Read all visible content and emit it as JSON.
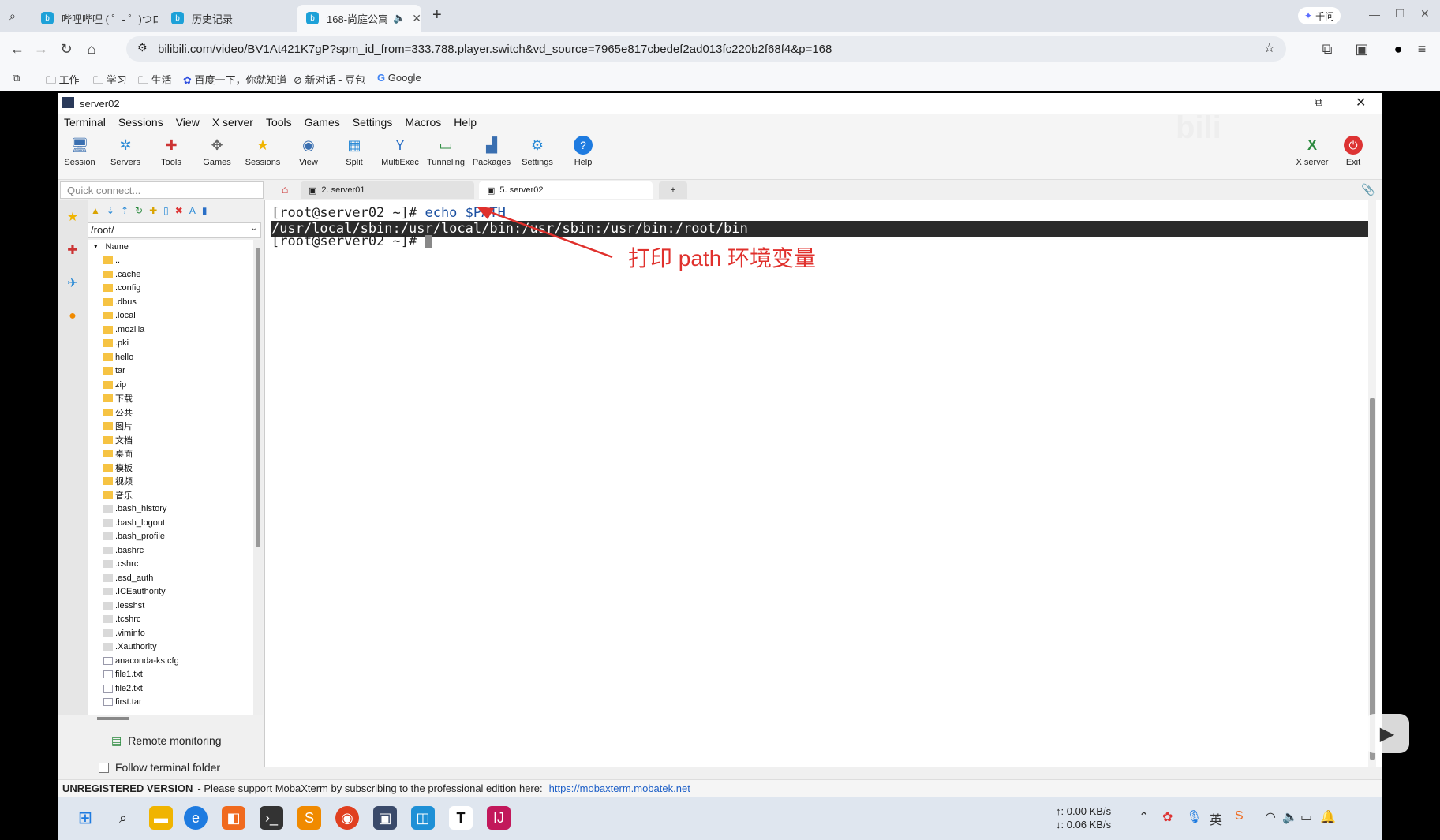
{
  "browser": {
    "tabs": [
      {
        "label": "哔哩哔哩 ( ゜- ゜)つロ"
      },
      {
        "label": "历史记录"
      },
      {
        "label": "168-尚庭公寓"
      }
    ],
    "qianwen": "千问",
    "url": "bilibili.com/video/BV1At421K7gP?spm_id_from=333.788.player.switch&vd_source=7965e817cbedef2ad013fc220b2f68f4&p=168",
    "bookmarks": [
      "工作",
      "学习",
      "生活",
      "百度一下，你就知道",
      "新对话 - 豆包",
      "Google"
    ]
  },
  "moba": {
    "title": "server02",
    "menu": [
      "Terminal",
      "Sessions",
      "View",
      "X server",
      "Tools",
      "Games",
      "Settings",
      "Macros",
      "Help"
    ],
    "toolbar": [
      "Session",
      "Servers",
      "Tools",
      "Games",
      "Sessions",
      "View",
      "Split",
      "MultiExec",
      "Tunneling",
      "Packages",
      "Settings",
      "Help"
    ],
    "xserver": "X server",
    "exit": "Exit",
    "quick_connect": "Quick connect...",
    "session_tabs": [
      "2. server01",
      "5. server02"
    ],
    "path": "/root/",
    "tree_header": "Name",
    "files": [
      "..",
      ".cache",
      ".config",
      ".dbus",
      ".local",
      ".mozilla",
      ".pki",
      "hello",
      "tar",
      "zip",
      "下载",
      "公共",
      "图片",
      "文档",
      "桌面",
      "模板",
      "视频",
      "音乐",
      ".bash_history",
      ".bash_logout",
      ".bash_profile",
      ".bashrc",
      ".cshrc",
      ".esd_auth",
      ".ICEauthority",
      ".lesshst",
      ".tcshrc",
      ".viminfo",
      ".Xauthority",
      "anaconda-ks.cfg",
      "file1.txt",
      "file2.txt",
      "first.tar"
    ],
    "remote_monitoring": "Remote monitoring",
    "follow_folder": "Follow terminal folder",
    "terminal": {
      "prompt1": "[root@server02 ~]# ",
      "cmd": "echo $PATH",
      "output": "/usr/local/sbin:/usr/local/bin:/usr/sbin:/usr/bin:/root/bin",
      "prompt2": "[root@server02 ~]# "
    },
    "annotation": "打印 path 环境变量",
    "status": {
      "unreg": "UNREGISTERED VERSION",
      "text": "-  Please support MobaXterm by subscribing to the professional edition here:",
      "link": "https://mobaxterm.mobatek.net"
    }
  },
  "taskbar": {
    "net_up": "↑: 0.00 KB/s",
    "net_down": "↓: 0.06 KB/s"
  }
}
